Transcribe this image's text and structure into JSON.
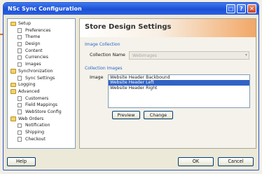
{
  "window": {
    "title": "NSc Sync Configuration"
  },
  "titlebar_buttons": [
    {
      "name": "maximize-icon",
      "glyph": "□"
    },
    {
      "name": "help-icon",
      "glyph": "?"
    },
    {
      "name": "close-icon",
      "glyph": "✕"
    }
  ],
  "tree": [
    {
      "label": "Setup",
      "kind": "folder",
      "level": 0
    },
    {
      "label": "Preferences",
      "kind": "page",
      "level": 1
    },
    {
      "label": "Theme",
      "kind": "page",
      "level": 1
    },
    {
      "label": "Design",
      "kind": "page",
      "level": 1
    },
    {
      "label": "Content",
      "kind": "page",
      "level": 1
    },
    {
      "label": "Currencies",
      "kind": "page",
      "level": 1
    },
    {
      "label": "Images",
      "kind": "page",
      "level": 1
    },
    {
      "label": "Synchronization",
      "kind": "folder",
      "level": 0
    },
    {
      "label": "Sync Settings",
      "kind": "page",
      "level": 1
    },
    {
      "label": "Logging",
      "kind": "folder",
      "level": 0
    },
    {
      "label": "Advanced",
      "kind": "folder",
      "level": 0
    },
    {
      "label": "Customers",
      "kind": "page",
      "level": 1
    },
    {
      "label": "Field Mappings",
      "kind": "page",
      "level": 1
    },
    {
      "label": "WebStore Config",
      "kind": "page",
      "level": 1
    },
    {
      "label": "Web Orders",
      "kind": "folder",
      "level": 0
    },
    {
      "label": "Notification",
      "kind": "page",
      "level": 1
    },
    {
      "label": "Shipping",
      "kind": "page",
      "level": 1
    },
    {
      "label": "Checkout",
      "kind": "page",
      "level": 1
    }
  ],
  "panel": {
    "title": "Store Design Settings",
    "collection_section": "Image Collection",
    "collection_name_label": "Collection Name",
    "collection_name_value": "Webimages",
    "images_section": "Collection Images",
    "image_label": "Image",
    "images": [
      {
        "label": "Website Header Backbound",
        "selected": false
      },
      {
        "label": "Website Header Left",
        "selected": true
      },
      {
        "label": "Website Header Right",
        "selected": false
      }
    ],
    "preview_button": "Preview",
    "change_button": "Change"
  },
  "footer": {
    "help_button": "Help",
    "ok_button": "OK",
    "cancel_button": "Cancel"
  },
  "colors": {
    "titlebar": "#2a61e6",
    "accent": "#e2701f",
    "selection": "#3163c5",
    "section_label": "#2b63c9"
  }
}
